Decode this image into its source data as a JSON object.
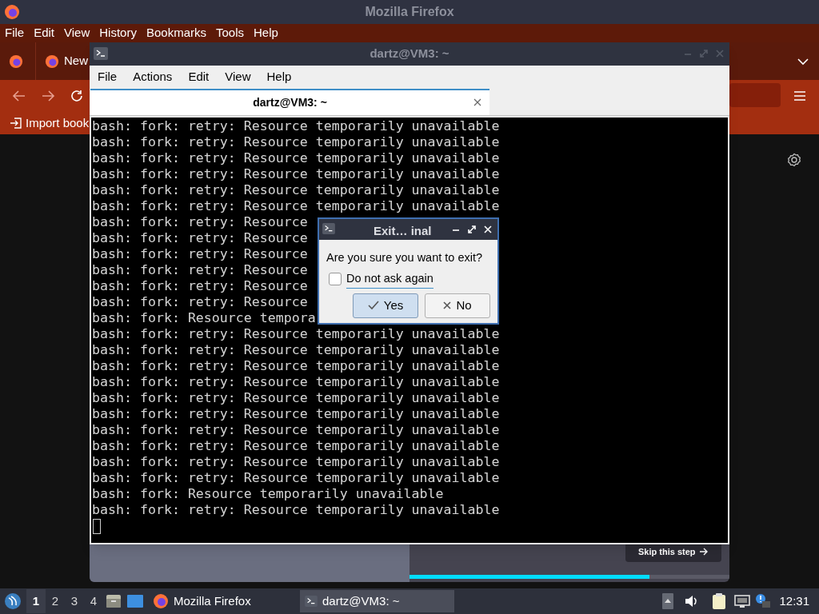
{
  "firefox": {
    "title": "Mozilla Firefox",
    "menu": [
      {
        "label": "File"
      },
      {
        "label": "Edit"
      },
      {
        "label": "View"
      },
      {
        "label": "History"
      },
      {
        "label": "Bookmarks"
      },
      {
        "label": "Tools"
      },
      {
        "label": "Help"
      }
    ],
    "tab_label": "New",
    "bookmark": "Import book",
    "onboarding": {
      "skip_label": "Skip this step",
      "progress": {
        "level": 0.75
      }
    }
  },
  "terminal": {
    "title": "dartz@VM3: ~",
    "menu": [
      "File",
      "Actions",
      "Edit",
      "View",
      "Help"
    ],
    "tabs": [
      {
        "label": "dartz@VM3: ~",
        "selected": true
      }
    ],
    "lines": [
      "bash: fork: retry: Resource temporarily unavailable",
      "bash: fork: retry: Resource temporarily unavailable",
      "bash: fork: retry: Resource temporarily unavailable",
      "bash: fork: retry: Resource temporarily unavailable",
      "bash: fork: retry: Resource temporarily unavailable",
      "bash: fork: retry: Resource temporarily unavailable",
      "bash: fork: retry: Resource",
      "bash: fork: retry: Resource",
      "bash: fork: retry: Resource",
      "bash: fork: retry: Resource",
      "bash: fork: retry: Resource",
      "bash: fork: retry: Resource",
      "bash: fork: Resource tempora",
      "bash: fork: retry: Resource temporarily unavailable",
      "bash: fork: retry: Resource temporarily unavailable",
      "bash: fork: retry: Resource temporarily unavailable",
      "bash: fork: retry: Resource temporarily unavailable",
      "bash: fork: retry: Resource temporarily unavailable",
      "bash: fork: retry: Resource temporarily unavailable",
      "bash: fork: retry: Resource temporarily unavailable",
      "bash: fork: retry: Resource temporarily unavailable",
      "bash: fork: retry: Resource temporarily unavailable",
      "bash: fork: retry: Resource temporarily unavailable",
      "bash: fork: Resource temporarily unavailable",
      "bash: fork: retry: Resource temporarily unavailable"
    ]
  },
  "dialog": {
    "title": "Exit… inal",
    "message": "Are you sure you want to exit?",
    "checkbox": {
      "label": "Do not ask again",
      "checked": false
    },
    "buttons": [
      {
        "label": "Yes",
        "kind": "yes",
        "selected": true
      },
      {
        "label": "No",
        "kind": "no",
        "selected": false
      }
    ]
  },
  "taskbar": {
    "workspaces": [
      {
        "label": "1",
        "selected": true
      },
      {
        "label": "2",
        "selected": false
      },
      {
        "label": "3",
        "selected": false
      },
      {
        "label": "4",
        "selected": false
      }
    ],
    "tasks": [
      {
        "label": "Mozilla Firefox",
        "kind": "firefox",
        "selected": false
      },
      {
        "label": "dartz@VM3: ~",
        "kind": "terminal",
        "selected": true
      }
    ],
    "clock": "12:31"
  }
}
